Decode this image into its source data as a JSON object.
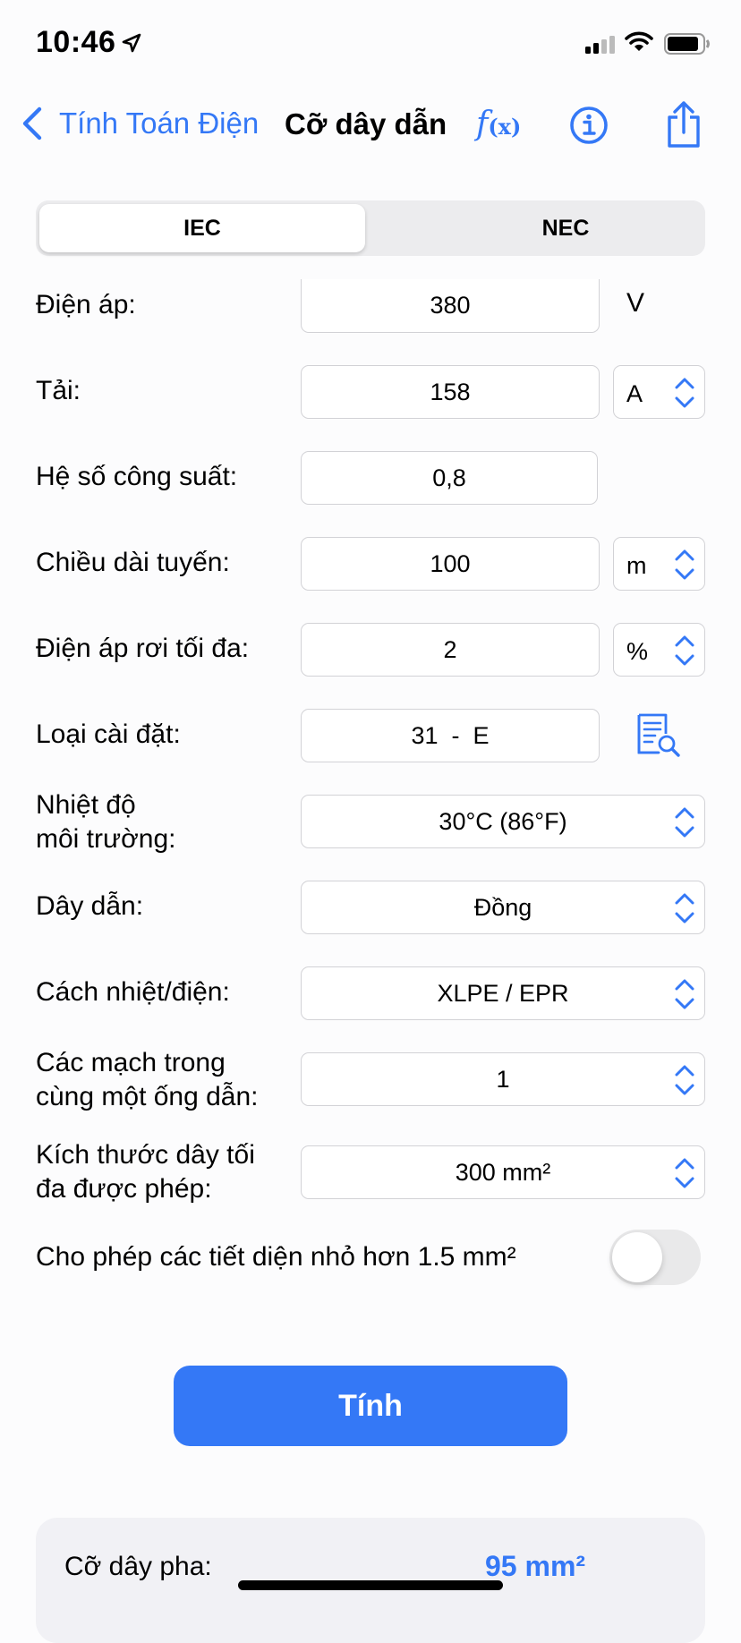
{
  "status_bar": {
    "time": "10:46"
  },
  "nav": {
    "back_label": "Tính Toán Điện",
    "title": "Cỡ dây dẫn",
    "fx_label": "f",
    "fx_sub": "(x)"
  },
  "standard_tabs": [
    "IEC",
    "NEC"
  ],
  "form": {
    "voltage": {
      "label": "Điện áp:",
      "value": "380",
      "unit": "V"
    },
    "load": {
      "label": "Tải:",
      "value": "158",
      "unit": "A"
    },
    "power_factor": {
      "label": "Hệ số công suất:",
      "value": "0,8"
    },
    "length": {
      "label": "Chiều dài tuyến:",
      "value": "100",
      "unit": "m"
    },
    "voltage_drop": {
      "label": "Điện áp rơi tối đa:",
      "value": "2",
      "unit": "%"
    },
    "install_type": {
      "label": "Loại cài đặt:",
      "value": "31  -  E"
    },
    "ambient_temp": {
      "label_line1": "Nhiệt độ",
      "label_line2": "môi trường:",
      "value": "30°C (86°F)"
    },
    "conductor": {
      "label": "Dây dẫn:",
      "value": "Đồng"
    },
    "insulation": {
      "label": "Cách nhiệt/điện:",
      "value": "XLPE / EPR"
    },
    "circuits": {
      "label_line1": "Các mạch trong",
      "label_line2": "cùng một ống dẫn:",
      "value": "1"
    },
    "max_size": {
      "label_line1": "Kích thước dây tối",
      "label_line2": "đa được phép:",
      "value": "300 mm²"
    },
    "allow_small": {
      "label": "Cho phép các tiết diện nhỏ hơn 1.5 mm²",
      "enabled": false
    }
  },
  "calculate_label": "Tính",
  "result": {
    "label": "Cỡ dây pha:",
    "value": "95 mm²"
  },
  "colors": {
    "accent": "#3478f6",
    "field_border": "#d2d2d6",
    "segment_bg": "#ececee"
  }
}
